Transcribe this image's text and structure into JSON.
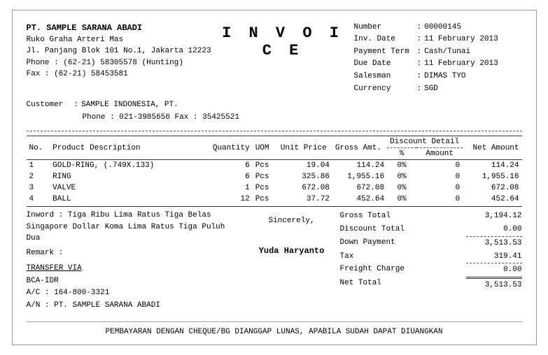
{
  "company": {
    "name": "PT. SAMPLE SARANA ABADI",
    "address1": "Ruko Graha Arteri Mas",
    "address2": "Jl. Panjang Blok 101 No.1, Jakarta 12223",
    "phone": "Phone  :  (62-21) 58305578 (Hunting)",
    "fax": "Fax      :  (62-21) 58453581"
  },
  "invoice_title": "I N V O I C E",
  "meta": {
    "number_label": "Number",
    "number_value": "00000145",
    "inv_date_label": "Inv. Date",
    "inv_date_value": "11 February 2013",
    "payment_term_label": "Payment Term",
    "payment_term_value": "Cash/Tunai",
    "due_date_label": "Due Date",
    "due_date_value": "11 February 2013",
    "salesman_label": "Salesman",
    "salesman_value": "DIMAS TYO",
    "currency_label": "Currency",
    "currency_value": "SGD"
  },
  "customer": {
    "label": "Customer",
    "name": "SAMPLE  INDONESIA, PT.",
    "phone_fax": "Phone : 021-3985656   Fax : 35425521"
  },
  "table": {
    "headers": {
      "no": "No.",
      "product_desc": "Product Description",
      "quantity": "Quantity",
      "uom": "UOM",
      "unit_price": "Unit Price",
      "gross_amt": "Gross Amt.",
      "discount_detail": "Discount Detail",
      "disc_pct": "%",
      "disc_amt": "Amount",
      "net_amount": "Net Amount"
    },
    "rows": [
      {
        "no": "1",
        "desc": "GOLD-RING, (.749X.133)",
        "qty": "6",
        "uom": "Pcs",
        "unit_price": "19.04",
        "gross_amt": "114.24",
        "disc_pct": "0%",
        "disc_amt": "0",
        "net_amt": "114.24"
      },
      {
        "no": "2",
        "desc": "RING",
        "qty": "6",
        "uom": "Pcs",
        "unit_price": "325.86",
        "gross_amt": "1,955.16",
        "disc_pct": "0%",
        "disc_amt": "0",
        "net_amt": "1,955.16"
      },
      {
        "no": "3",
        "desc": "VALVE",
        "qty": "1",
        "uom": "Pcs",
        "unit_price": "672.08",
        "gross_amt": "672.08",
        "disc_pct": "0%",
        "disc_amt": "0",
        "net_amt": "672.08"
      },
      {
        "no": "4",
        "desc": "BALL",
        "qty": "12",
        "uom": "Pcs",
        "unit_price": "37.72",
        "gross_amt": "452.64",
        "disc_pct": "0%",
        "disc_amt": "0",
        "net_amt": "452.64"
      }
    ]
  },
  "inword_label": "Inword :",
  "inword_text": "Tiga Ribu Lima Ratus Tiga Belas Singapore Dollar Koma Lima Ratus Tiga Puluh Dua",
  "remark_label": "Remark :",
  "sincerely": "Sincerely,",
  "signatory": "Yuda Haryanto",
  "transfer": {
    "label": "TRANSFER VIA",
    "bank": "BCA-IDR",
    "account": "A/C : 164-800-3321",
    "account_name": "A/N : PT. SAMPLE SARANA ABADI"
  },
  "summary": {
    "gross_total_label": "Gross Total",
    "gross_total_value": "3,194.12",
    "discount_total_label": "Discount Total",
    "discount_total_value": "0.00",
    "down_payment_label": "Down Payment",
    "down_payment_value": "3,513.53",
    "tax_label": "Tax",
    "tax_value": "319.41",
    "freight_label": "Freight Charge",
    "freight_value": "0.00",
    "net_total_label": "Net Total",
    "net_total_value": "3,513.53"
  },
  "footer_note": "PEMBAYARAN DENGAN CHEQUE/BG DIANGGAP LUNAS, APABILA SUDAH DAPAT DIUANGKAN"
}
